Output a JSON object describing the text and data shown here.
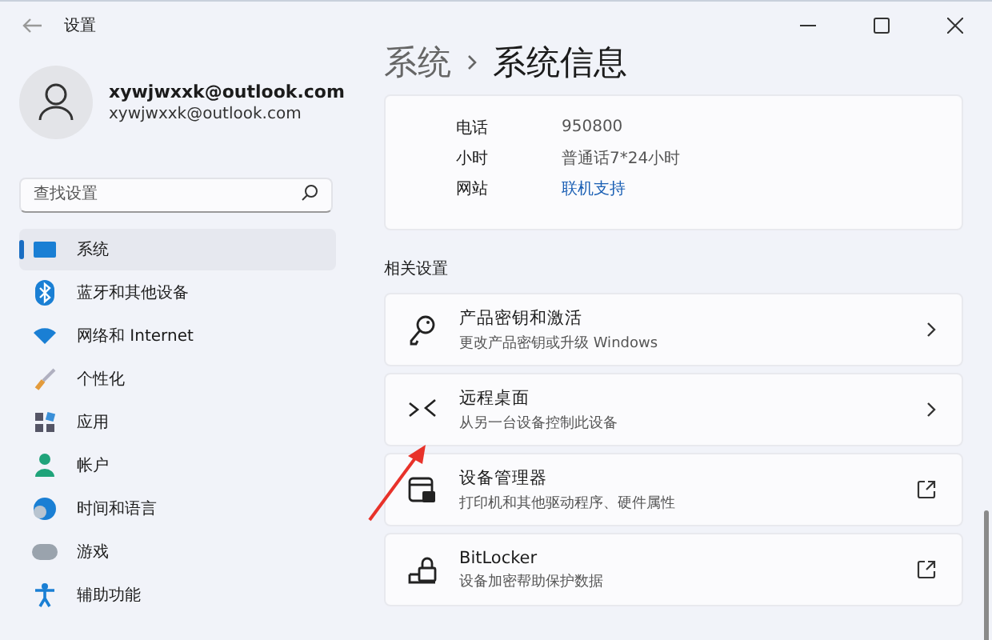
{
  "window": {
    "title": "设置"
  },
  "account": {
    "name": "xywjwxxk@outlook.com",
    "email": "xywjwxxk@outlook.com"
  },
  "search": {
    "placeholder": "查找设置"
  },
  "sidebar": {
    "items": [
      {
        "label": "系统",
        "kind": "system",
        "selected": true
      },
      {
        "label": "蓝牙和其他设备",
        "kind": "bluetooth",
        "selected": false
      },
      {
        "label": "网络和 Internet",
        "kind": "wifi",
        "selected": false
      },
      {
        "label": "个性化",
        "kind": "brush",
        "selected": false
      },
      {
        "label": "应用",
        "kind": "apps",
        "selected": false
      },
      {
        "label": "帐户",
        "kind": "person",
        "selected": false
      },
      {
        "label": "时间和语言",
        "kind": "globe",
        "selected": false
      },
      {
        "label": "游戏",
        "kind": "gamepad",
        "selected": false
      },
      {
        "label": "辅助功能",
        "kind": "access",
        "selected": false
      }
    ]
  },
  "breadcrumb": [
    "系统",
    "系统信息"
  ],
  "support": {
    "rows": [
      {
        "label": "电话",
        "value": "950800",
        "kind": "text"
      },
      {
        "label": "小时",
        "value": "普通话7*24小时",
        "kind": "text"
      },
      {
        "label": "网站",
        "value": "联机支持",
        "kind": "link"
      }
    ]
  },
  "related": {
    "heading": "相关设置",
    "items": [
      {
        "title": "产品密钥和激活",
        "subtitle": "更改产品密钥或升级 Windows",
        "kind": "key"
      },
      {
        "title": "远程桌面",
        "subtitle": "从另一台设备控制此设备",
        "kind": "remote"
      },
      {
        "title": "设备管理器",
        "subtitle": "打印机和其他驱动程序、硬件属性",
        "kind": "devmgr"
      },
      {
        "title": "BitLocker",
        "subtitle": "设备加密帮助保护数据",
        "kind": "lock"
      }
    ]
  }
}
